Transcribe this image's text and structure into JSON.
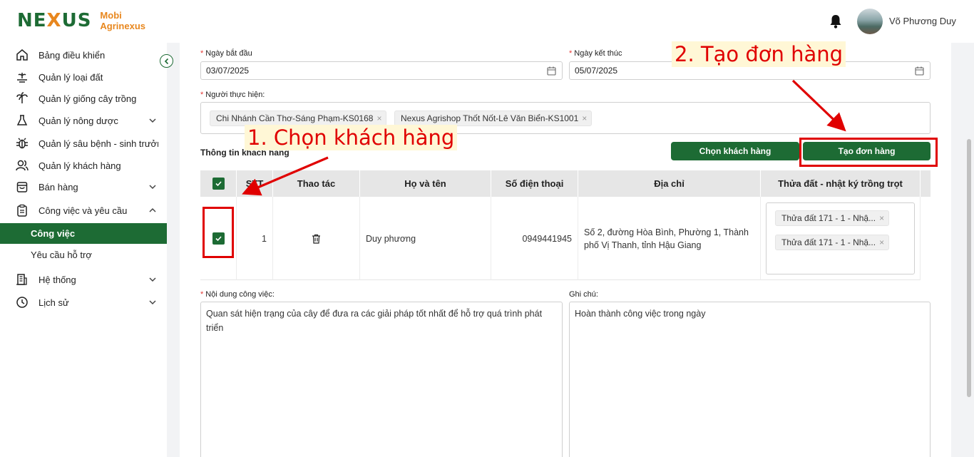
{
  "header": {
    "logo_mark_left": "NE",
    "logo_mark_x": "X",
    "logo_mark_right": "US",
    "brand_line1": "Mobi",
    "brand_line2": "Agrinexus",
    "user_name": "Võ Phương Duy",
    "icons": [
      "bell-icon",
      "avatar"
    ]
  },
  "sidebar": {
    "items": [
      {
        "label": "Bảng điều khiển",
        "icon": "home-icon"
      },
      {
        "label": "Quản lý loại đất",
        "icon": "soil-icon"
      },
      {
        "label": "Quản lý giống cây trồng",
        "icon": "palm-tree-icon"
      },
      {
        "label": "Quản lý nông dược",
        "icon": "flask-icon"
      },
      {
        "label": "Quản lý sâu bệnh - sinh trưởng",
        "icon": "bug-icon"
      },
      {
        "label": "Quản lý khách hàng",
        "icon": "users-icon"
      },
      {
        "label": "Bán hàng",
        "icon": "shopping-bag-icon"
      },
      {
        "label": "Công việc và yêu cầu",
        "icon": "clipboard-icon"
      },
      {
        "label": "Hệ thống",
        "icon": "building-icon"
      },
      {
        "label": "Lịch sử",
        "icon": "history-icon"
      }
    ],
    "sub_items": [
      {
        "label": "Công việc",
        "active": true
      },
      {
        "label": "Yêu cầu hỗ trợ",
        "active": false
      }
    ],
    "active_color": "#1d6b34"
  },
  "form": {
    "start_date_label": "Ngày bắt đầu",
    "start_date_value": "03/07/2025",
    "end_date_label": "Ngày kết thúc",
    "end_date_value": "05/07/2025",
    "performer_label": "Người thực hiện:",
    "performers": [
      "Chi Nhánh Cần Thơ-Sáng Phạm-KS0168",
      "Nexus Agrishop Thốt Nốt-Lê  Văn Biển-KS1001"
    ],
    "customer_section_title": "Thông tin khách hàng",
    "choose_customer_button": "Chọn khách hàng",
    "create_order_button": "Tạo đơn hàng",
    "content_label": "Nội dung công việc:",
    "content_value": "Quan sát hiện trạng của cây để đưa ra các giải pháp tốt nhất để hỗ trợ quá trình phát triển",
    "note_label": "Ghi chú:",
    "note_value": "Hoàn thành công việc trong ngày"
  },
  "table": {
    "columns": [
      "STT",
      "Thao tác",
      "Họ và tên",
      "Số điện thoại",
      "Địa chỉ",
      "Thửa đất - nhật ký trồng trọt"
    ],
    "rows": [
      {
        "checked": true,
        "stt": "1",
        "name": "Duy phương",
        "phone": "0949441945",
        "address": "Số 2, đường Hòa Bình, Phường 1, Thành phố Vị Thanh, tỉnh Hậu Giang",
        "plots": [
          "Thửa đất 171 - 1 - Nhậ...",
          "Thửa đất 171 - 1 - Nhậ..."
        ]
      }
    ]
  },
  "annotations": {
    "step1": "1. Chọn khách hàng",
    "step2": "2. Tạo đơn hàng",
    "color": "#e00000"
  }
}
